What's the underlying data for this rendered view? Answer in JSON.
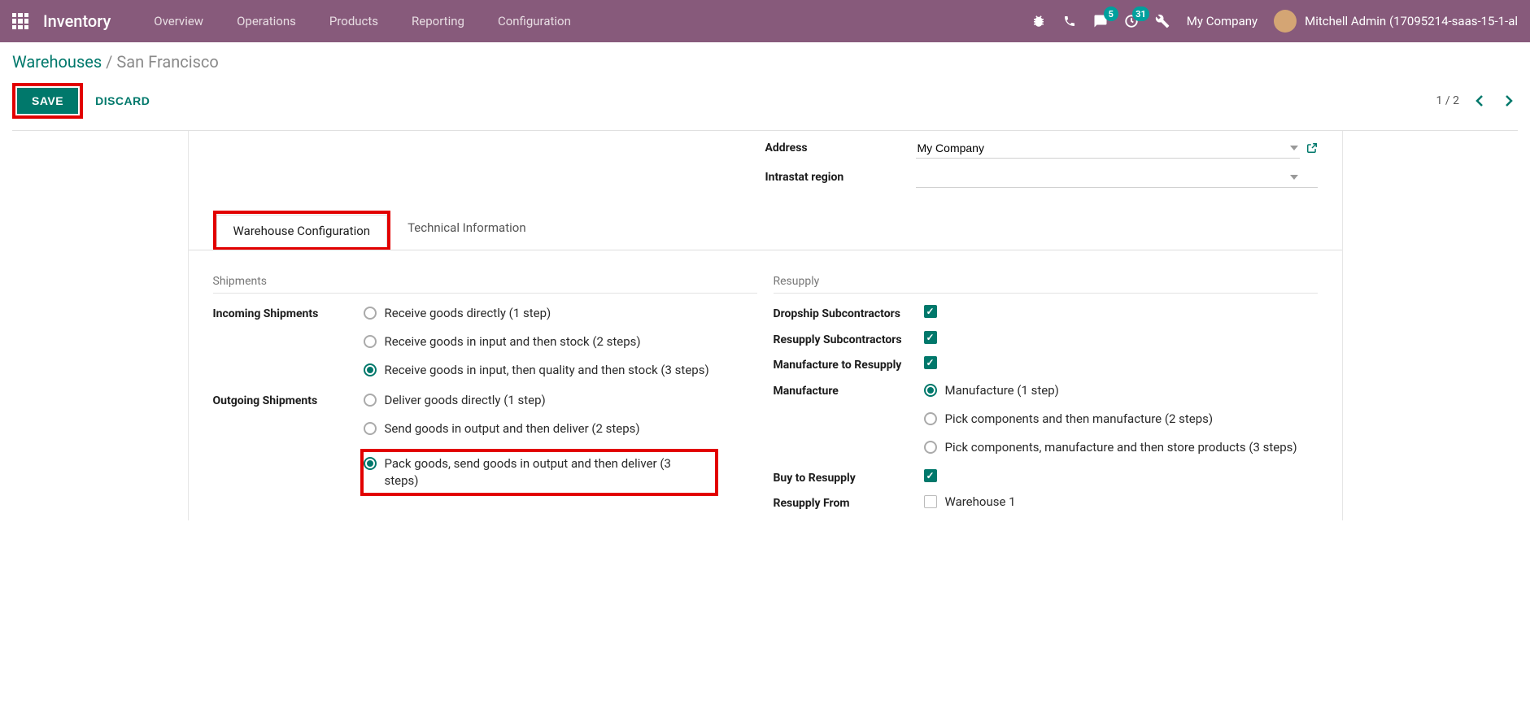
{
  "nav": {
    "app_title": "Inventory",
    "menu": [
      "Overview",
      "Operations",
      "Products",
      "Reporting",
      "Configuration"
    ],
    "chat_badge": "5",
    "activity_badge": "31",
    "company": "My Company",
    "user": "Mitchell Admin (17095214-saas-15-1-al"
  },
  "breadcrumb": {
    "root": "Warehouses",
    "current": "San Francisco"
  },
  "actions": {
    "save": "SAVE",
    "discard": "DISCARD",
    "pager": "1 / 2"
  },
  "form": {
    "address_label": "Address",
    "address_value": "My Company",
    "intrastat_label": "Intrastat region",
    "intrastat_value": ""
  },
  "tabs": {
    "warehouse_config": "Warehouse Configuration",
    "technical_info": "Technical Information"
  },
  "ship": {
    "section": "Shipments",
    "incoming_label": "Incoming Shipments",
    "incoming_options": [
      "Receive goods directly (1 step)",
      "Receive goods in input and then stock (2 steps)",
      "Receive goods in input, then quality and then stock (3 steps)"
    ],
    "outgoing_label": "Outgoing Shipments",
    "outgoing_options": [
      "Deliver goods directly (1 step)",
      "Send goods in output and then deliver (2 steps)",
      "Pack goods, send goods in output and then deliver (3 steps)"
    ]
  },
  "resupply": {
    "section": "Resupply",
    "dropship_label": "Dropship Subcontractors",
    "resupply_sub_label": "Resupply Subcontractors",
    "mfg_resupply_label": "Manufacture to Resupply",
    "manufacture_label": "Manufacture",
    "manufacture_options": [
      "Manufacture (1 step)",
      "Pick components and then manufacture (2 steps)",
      "Pick components, manufacture and then store products (3 steps)"
    ],
    "buy_label": "Buy to Resupply",
    "resupply_from_label": "Resupply From",
    "resupply_from_option": "Warehouse 1"
  }
}
